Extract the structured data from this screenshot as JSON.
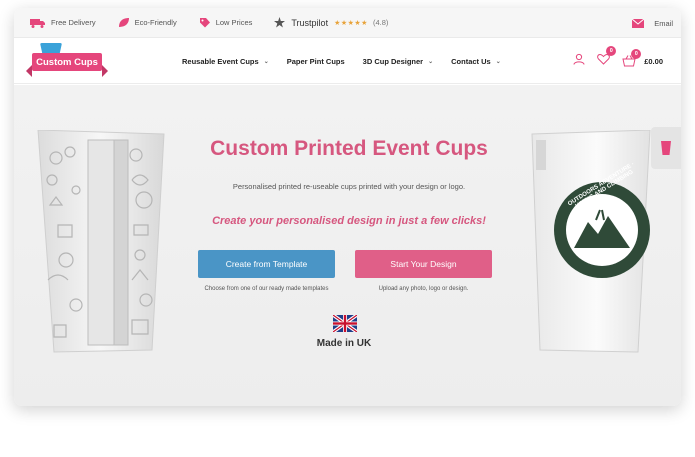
{
  "topbar": {
    "delivery": "Free Delivery",
    "eco": "Eco-Friendly",
    "prices": "Low Prices",
    "trustpilot": "Trustpilot",
    "stars": "★★★★★",
    "rating": "(4.8)",
    "email": "Email"
  },
  "logo": {
    "text": "Custom Cups"
  },
  "nav": {
    "items": [
      {
        "label": "Reusable Event Cups",
        "has_dropdown": true
      },
      {
        "label": "Paper Pint Cups",
        "has_dropdown": false
      },
      {
        "label": "3D Cup Designer",
        "has_dropdown": true
      },
      {
        "label": "Contact Us",
        "has_dropdown": true
      }
    ],
    "chevron": "⌄"
  },
  "header": {
    "wishlist_count": "0",
    "cart_count": "0",
    "cart_total": "£0.00"
  },
  "hero": {
    "title": "Custom Printed Event Cups",
    "subtitle": "Personalised printed re-useable cups printed with your design or logo.",
    "tagline": "Create your personalised design in just a few clicks!",
    "btn_template": "Create from Template",
    "btn_template_caption": "Choose from one of our ready made templates",
    "btn_start": "Start Your Design",
    "btn_start_caption": "Upload any photo, logo or design.",
    "made_in": "Made in UK",
    "right_cup_text": "OUTDOORS ADVENTURE · HIKING AND CLIMBING"
  },
  "colors": {
    "brand_pink": "#e05f88",
    "title_pink": "#d6577f",
    "blue": "#4a95c6"
  }
}
